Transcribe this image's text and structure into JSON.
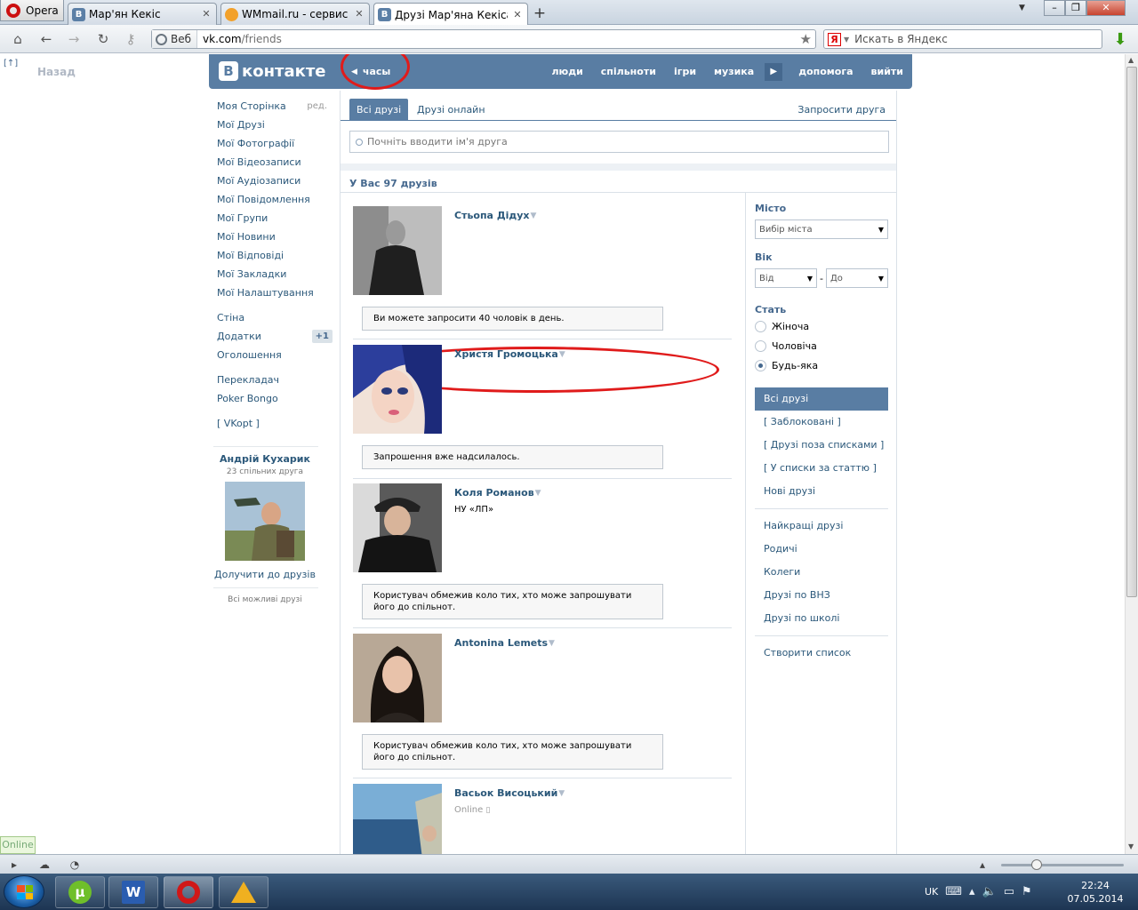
{
  "browser": {
    "menu_label": "Opera",
    "tabs": [
      {
        "label": "Мар'ян Кекіс",
        "favicon": "vk-icon",
        "active": false
      },
      {
        "label": "WMmail.ru - сервис п...",
        "favicon": "wmmail-icon",
        "active": false
      },
      {
        "label": "Друзі Мар'яна Кекіса |...",
        "favicon": "vk-icon",
        "active": true
      }
    ],
    "url_scheme_label": "Веб",
    "url_host": "vk.com",
    "url_path": "/friends",
    "search_placeholder": "Искать в Яндекс",
    "search_engine_letter": "Я"
  },
  "page": {
    "back_up": "[↑]",
    "back_label": "Назад"
  },
  "header": {
    "logo_letter": "В",
    "logo_text": "контакте",
    "back_label": "часы",
    "nav": [
      "люди",
      "спільноти",
      "ігри",
      "музика",
      "допомога",
      "вийти"
    ]
  },
  "leftnav": {
    "group1": [
      "Моя Сторінка",
      "Мої Друзі",
      "Мої Фотографії",
      "Мої Відеозаписи",
      "Мої Аудіозаписи",
      "Мої Повідомлення",
      "Мої Групи",
      "Мої Новини",
      "Мої Відповіді",
      "Мої Закладки",
      "Мої Налаштування"
    ],
    "edit_label": "ред.",
    "group2": [
      "Стіна",
      "Додатки",
      "Оголошення"
    ],
    "apps_badge": "+1",
    "group3": [
      "Перекладач",
      "Poker Bongo"
    ],
    "group4": [
      "[ VKopt ]"
    ]
  },
  "suggestion": {
    "name": "Андрій Кухарик",
    "common": "23 спільних друга",
    "add_label": "Долучити до друзів",
    "all_label": "Всі можливі друзі"
  },
  "friends_tabs": {
    "all": "Всі друзі",
    "online": "Друзі онлайн",
    "invite": "Запросити друга"
  },
  "search": {
    "placeholder": "Почніть вводити ім'я друга"
  },
  "count_label": "У Вас 97 друзів",
  "friends": [
    {
      "name": "Стьопа Дідух",
      "sub": "",
      "note": "Ви можете запросити 40 чоловік в день."
    },
    {
      "name": "Христя Громоцька",
      "sub": "",
      "note": "Запрошення вже надсилалось."
    },
    {
      "name": "Коля Романов",
      "sub": "НУ «ЛП»",
      "note": "Користувач обмежив коло тих, хто може запрошувати його до спільнот."
    },
    {
      "name": "Antonina Lemets",
      "sub": "",
      "note": "Користувач обмежив коло тих, хто може запрошувати його до спільнот."
    },
    {
      "name": "Васьок Висоцький",
      "sub": "Online",
      "note": ""
    }
  ],
  "filters": {
    "city_title": "Місто",
    "city_select": "Вибір міста",
    "age_title": "Вік",
    "age_from": "Від",
    "age_dash": "-",
    "age_to": "До",
    "sex_title": "Стать",
    "sex_options": [
      "Жіноча",
      "Чоловіча",
      "Будь-яка"
    ],
    "sex_selected": "Будь-яка",
    "lists_a": [
      "Всі друзі",
      "[ Заблоковані ]",
      "[ Друзі поза списками ]",
      "[ У списки за статтю ]",
      "Нові друзі"
    ],
    "lists_b": [
      "Найкращі друзі",
      "Родичі",
      "Колеги",
      "Друзі по ВНЗ",
      "Друзі по школі"
    ],
    "create_list": "Створити список"
  },
  "online_tag": "Online",
  "tray": {
    "lang": "UK",
    "time": "22:24",
    "date": "07.05.2014"
  },
  "colors": {
    "vk_blue": "#597da3",
    "link": "#2b587a",
    "annotation_red": "#e01b1b"
  }
}
